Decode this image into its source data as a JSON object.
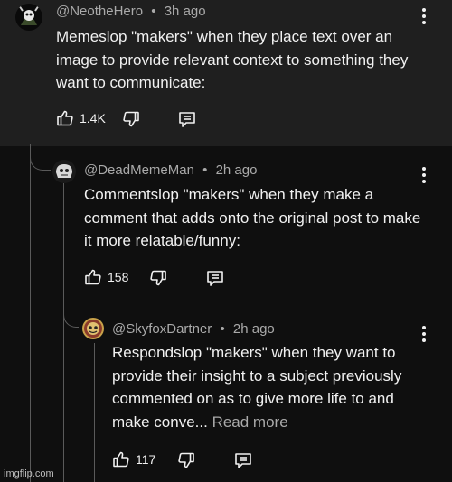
{
  "comments": [
    {
      "handle": "@NeotheHero",
      "time": "3h ago",
      "text": "Memeslop \"makers\" when they place text over an image to provide relevant context to something they want to communicate:",
      "likes": "1.4K"
    },
    {
      "handle": "@DeadMemeMan",
      "time": "2h ago",
      "text": "Commentslop \"makers\" when they make a comment that adds onto the original post to make it more relatable/funny:",
      "likes": "158"
    },
    {
      "handle": "@SkyfoxDartner",
      "time": "2h ago",
      "text": "Respondslop \"makers\" when they want to provide their insight to a subject previously commented on as to give more life to and make conve...",
      "read_more": "Read more",
      "likes": "117"
    }
  ],
  "separator": "•",
  "watermark": "imgflip.com",
  "icons": [
    "more-vert-icon",
    "thumb-up-icon",
    "thumb-down-icon",
    "reply-icon"
  ],
  "colors": {
    "top_panel": "#1f1f1f",
    "background": "#0f0f0f",
    "text": "#f1f1f1",
    "secondary_text": "#aaaaaa",
    "thread_line": "#5a5a5a"
  }
}
